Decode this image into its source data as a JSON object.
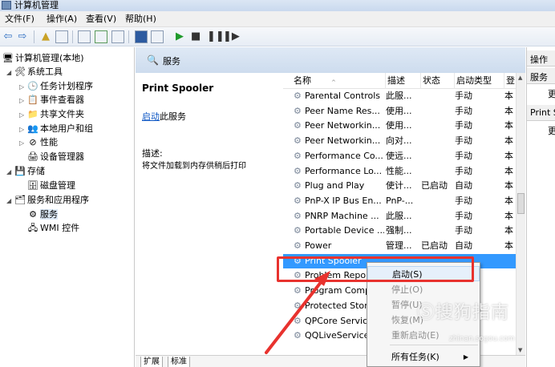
{
  "window": {
    "title": "计算机管理"
  },
  "menu": [
    "文件(F)",
    "操作(A)",
    "查看(V)",
    "帮助(H)"
  ],
  "tree": {
    "root": "计算机管理(本地)",
    "system_tools": "系统工具",
    "items": [
      "任务计划程序",
      "事件查看器",
      "共享文件夹",
      "本地用户和组",
      "性能",
      "设备管理器"
    ],
    "storage": "存储",
    "disk": "磁盘管理",
    "services_apps": "服务和应用程序",
    "services": "服务",
    "wmi": "WMI 控件"
  },
  "panel": {
    "title": "服务"
  },
  "detail": {
    "name": "Print Spooler",
    "start_link": "启动",
    "start_suffix": "此服务",
    "desc_label": "描述:",
    "desc": "将文件加载到内存供稍后打印"
  },
  "columns": {
    "name": "名称",
    "desc": "描述",
    "status": "状态",
    "startup": "启动类型",
    "logon": "登"
  },
  "services": [
    {
      "name": "Parental Controls",
      "desc": "此服...",
      "status": "",
      "startup": "手动",
      "logon": "本"
    },
    {
      "name": "Peer Name Res...",
      "desc": "使用...",
      "status": "",
      "startup": "手动",
      "logon": "本"
    },
    {
      "name": "Peer Networkin...",
      "desc": "使用...",
      "status": "",
      "startup": "手动",
      "logon": "本"
    },
    {
      "name": "Peer Networkin...",
      "desc": "向对...",
      "status": "",
      "startup": "手动",
      "logon": "本"
    },
    {
      "name": "Performance Co...",
      "desc": "使远...",
      "status": "",
      "startup": "手动",
      "logon": "本"
    },
    {
      "name": "Performance Lo...",
      "desc": "性能...",
      "status": "",
      "startup": "手动",
      "logon": "本"
    },
    {
      "name": "Plug and Play",
      "desc": "使计...",
      "status": "已启动",
      "startup": "自动",
      "logon": "本"
    },
    {
      "name": "PnP-X IP Bus En...",
      "desc": "PnP-...",
      "status": "",
      "startup": "手动",
      "logon": "本"
    },
    {
      "name": "PNRP Machine ...",
      "desc": "此服...",
      "status": "",
      "startup": "手动",
      "logon": "本"
    },
    {
      "name": "Portable Device ...",
      "desc": "强制...",
      "status": "",
      "startup": "手动",
      "logon": "本"
    },
    {
      "name": "Power",
      "desc": "管理...",
      "status": "已启动",
      "startup": "自动",
      "logon": "本"
    },
    {
      "name": "Print Spooler",
      "desc": "",
      "status": "",
      "startup": "",
      "logon": "",
      "selected": true
    },
    {
      "name": "Problem Repo",
      "desc": "",
      "status": "",
      "startup": "",
      "logon": ""
    },
    {
      "name": "Program Comp",
      "desc": "",
      "status": "",
      "startup": "",
      "logon": ""
    },
    {
      "name": "Protected Stor",
      "desc": "",
      "status": "",
      "startup": "",
      "logon": ""
    },
    {
      "name": "QPCore Service",
      "desc": "",
      "status": "",
      "startup": "",
      "logon": ""
    },
    {
      "name": "QQLiveService",
      "desc": "",
      "status": "",
      "startup": "",
      "logon": ""
    }
  ],
  "tabs": [
    "扩展",
    "标准"
  ],
  "actions": {
    "header": "操作",
    "group1": "服务",
    "item1": "更",
    "group2": "Print S",
    "item2": "更"
  },
  "context_menu": [
    {
      "label": "启动(S)",
      "enabled": true,
      "highlight": true
    },
    {
      "label": "停止(O)",
      "enabled": false
    },
    {
      "label": "暂停(U)",
      "enabled": false
    },
    {
      "label": "恢复(M)",
      "enabled": false
    },
    {
      "label": "重新启动(E)",
      "enabled": false
    },
    {
      "label": "所有任务(K)",
      "enabled": true,
      "submenu": true
    }
  ],
  "watermark": {
    "text": "搜狗指南",
    "sub": "zhinan.sogou.com"
  },
  "colors": {
    "selection": "#3399ff",
    "annotation": "#e8322e",
    "link": "#0b55c4"
  }
}
